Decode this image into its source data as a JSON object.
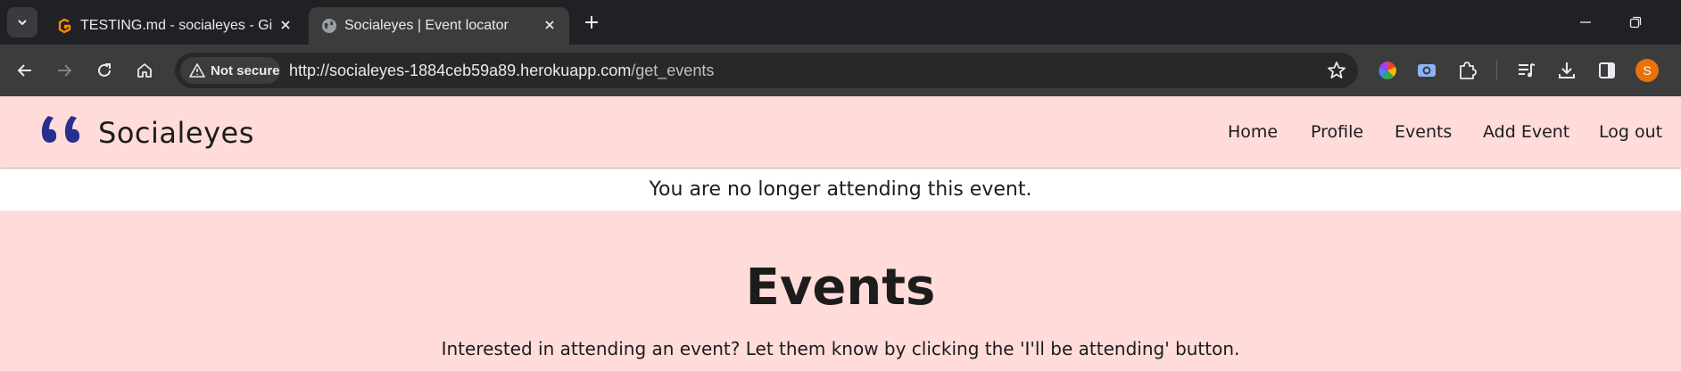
{
  "browser": {
    "tabs": [
      {
        "title": "TESTING.md - socialeyes - Gitpod",
        "favicon": "gitpod-icon",
        "active": false
      },
      {
        "title": "Socialeyes | Event locator",
        "favicon": "globe-icon",
        "active": true
      }
    ],
    "security_label": "Not secure",
    "url_host": "http://socialeyes-1884ceb59a89.herokuapp.com",
    "url_path": "/get_events",
    "profile_initial": "S"
  },
  "site": {
    "brand": "Socialeyes",
    "nav": [
      "Home",
      "Profile",
      "Events",
      "Add Event",
      "Log out"
    ],
    "flash_message": "You are no longer attending this event.",
    "heading": "Events",
    "lead": "Interested in attending an event? Let them know by clicking the 'I'll be attending' button."
  },
  "colors": {
    "page_background": "#ffdcda",
    "flash_background": "#ffffff",
    "logo_accent": "#27308f",
    "text": "#1c1c1c"
  }
}
